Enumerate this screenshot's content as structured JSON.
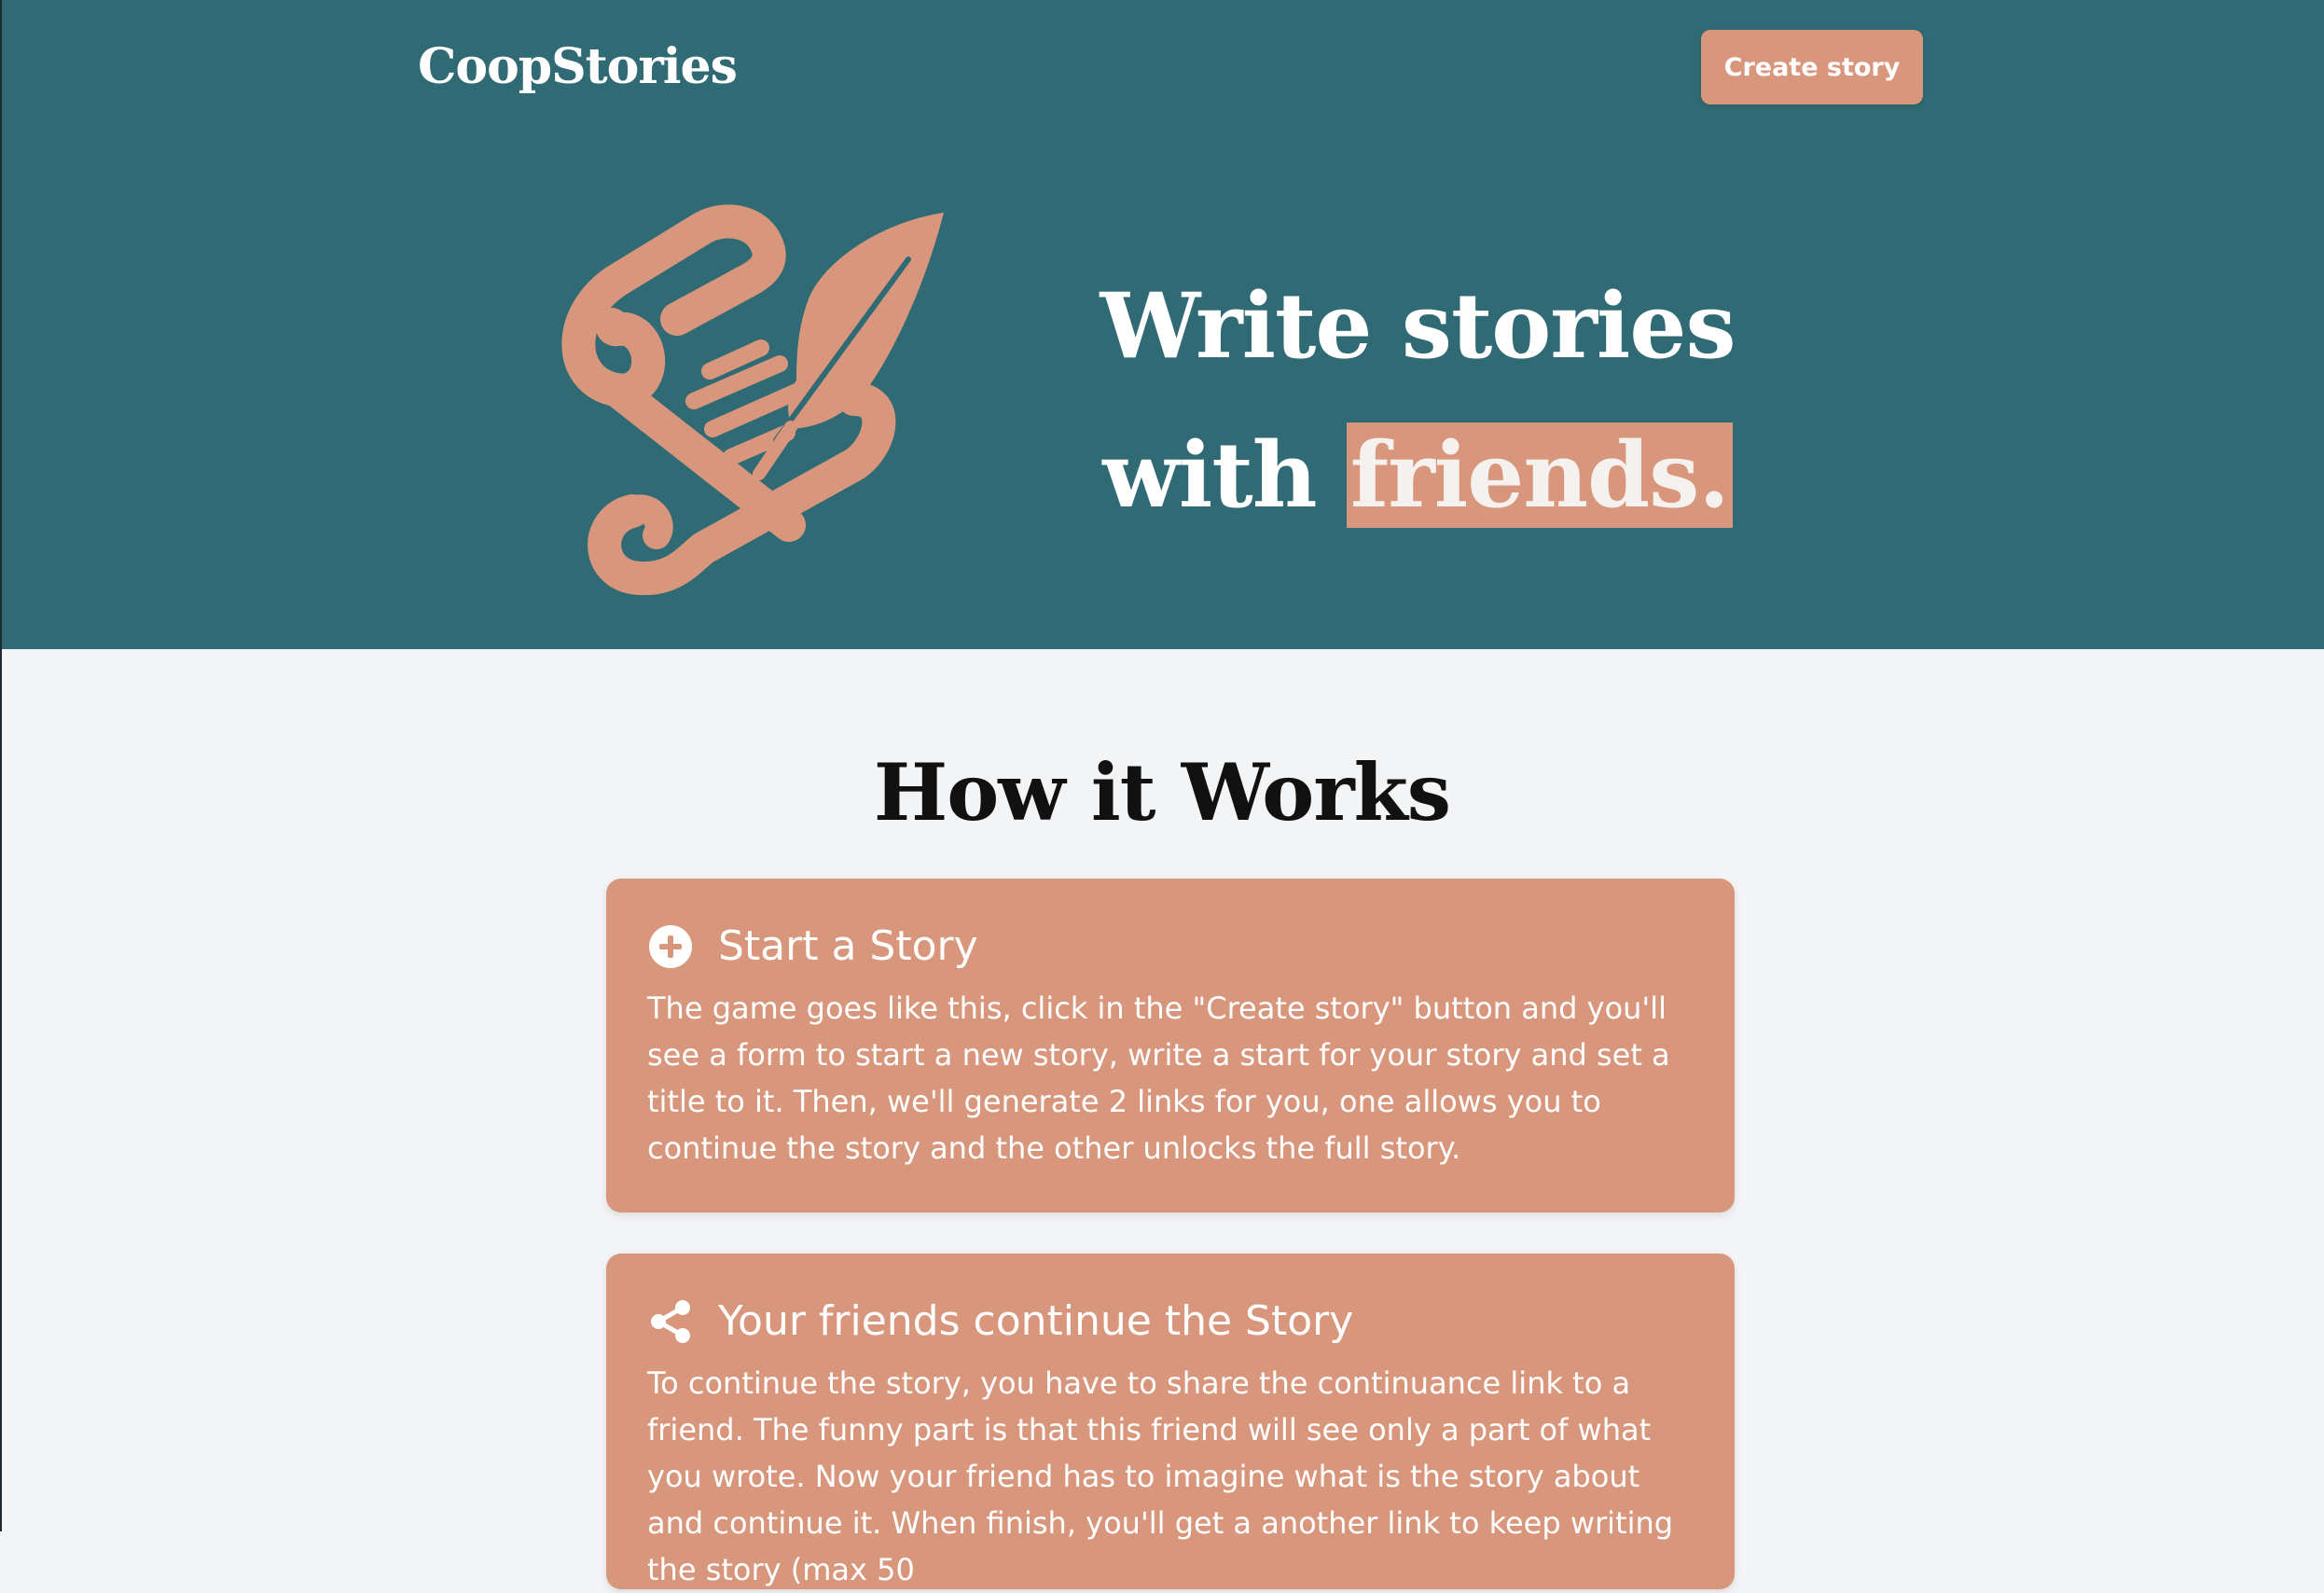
{
  "header": {
    "logo": "CoopStories",
    "create_button": "Create story"
  },
  "hero": {
    "illustration_icon": "scroll-quill-icon",
    "headline_line1": "Write stories",
    "headline_line2_plain": "with",
    "headline_line2_highlight": "friends."
  },
  "how_it_works": {
    "title": "How it Works",
    "cards": [
      {
        "icon": "plus-circle-icon",
        "title": "Start a Story",
        "body": "The game goes like this, click in the \"Create story\" button and you'll see a form to start a new story, write a start for your story and set a title to it. Then, we'll generate 2 links for you, one allows you to continue the story and the other unlocks the full story."
      },
      {
        "icon": "share-icon",
        "title": "Your friends continue the Story",
        "body": "To continue the story, you have to share the continuance link to a friend. The funny part is that this friend will see only a part of what you wrote. Now your friend has to imagine what is the story about and continue it. When finish, you'll get a another link to keep writing the story (max 50"
      }
    ]
  },
  "colors": {
    "hero_background": "#306b75",
    "accent": "#d8977c",
    "page_background": "#f3f4f6"
  }
}
